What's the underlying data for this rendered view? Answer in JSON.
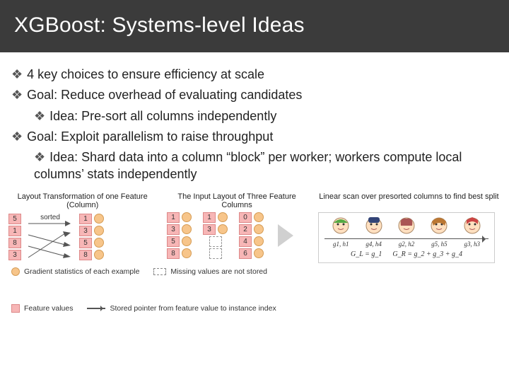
{
  "header": {
    "title": "XGBoost: Systems-level Ideas"
  },
  "bullets": {
    "b1": "4 key choices to ensure efficiency at scale",
    "b2": "Goal: Reduce overhead of evaluating candidates",
    "b2a": "Idea: Pre-sort all columns independently",
    "b3": "Goal: Exploit parallelism to raise throughput",
    "b3a": "Idea: Shard data into a column “block” per worker; workers compute local columns’ stats independently",
    "marker": "❖"
  },
  "dia_titles": {
    "t1": "Layout Transformation of one Feature (Column)",
    "t2": "The Input Layout of Three Feature Columns",
    "t3": "Linear scan over presorted columns to find best split"
  },
  "legend": {
    "l1": "Gradient statistics of each example",
    "l2": "Feature values",
    "l3": "Missing values are not stored",
    "l4": "Stored pointer from feature value to instance index"
  },
  "left_vals": {
    "a": "5",
    "b": "1",
    "c": "8",
    "d": "3"
  },
  "sorted_label": "sorted",
  "sorted_vals": {
    "a": "1",
    "b": "3",
    "c": "5",
    "d": "8"
  },
  "cols": {
    "c1": [
      "1",
      "3",
      "5",
      "8"
    ],
    "c2": [
      "1",
      "3",
      "",
      ""
    ],
    "c3": [
      "0",
      "2",
      "4",
      "6"
    ]
  },
  "axis": {
    "labels": [
      "g1, h1",
      "g4, h4",
      "g2, h2",
      "g5, h5",
      "g3, h3"
    ],
    "gl": "G_L = g_1",
    "gr": "G_R = g_2 + g_3 + g_4"
  }
}
